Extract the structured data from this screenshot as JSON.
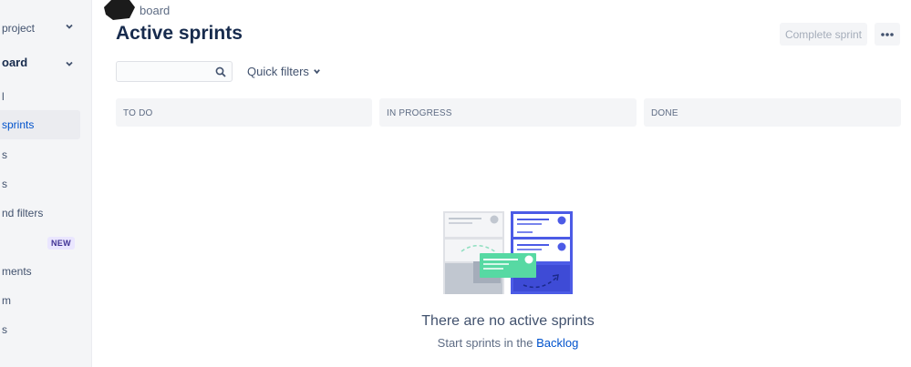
{
  "sidebar": {
    "project_label": "project",
    "board_label": "oard",
    "items": [
      {
        "label": "l"
      },
      {
        "label": "sprints"
      },
      {
        "label": "s"
      },
      {
        "label": "s"
      },
      {
        "label": "nd filters"
      },
      {
        "label": "",
        "badge": "NEW"
      },
      {
        "label": "ments"
      },
      {
        "label": "m"
      },
      {
        "label": "s"
      }
    ]
  },
  "header": {
    "breadcrumb": "board",
    "title": "Active sprints",
    "complete_sprint_label": "Complete sprint"
  },
  "search": {
    "value": "",
    "placeholder": ""
  },
  "filters": {
    "quick_filters_label": "Quick filters"
  },
  "board": {
    "columns": [
      "TO DO",
      "IN PROGRESS",
      "DONE"
    ]
  },
  "empty_state": {
    "title": "There are no active sprints",
    "subtitle_prefix": "Start sprints in the ",
    "backlog_link": "Backlog"
  },
  "colors": {
    "accent": "#0052cc",
    "illustration_blue": "#4c5be6",
    "illustration_green": "#57d9a3"
  }
}
